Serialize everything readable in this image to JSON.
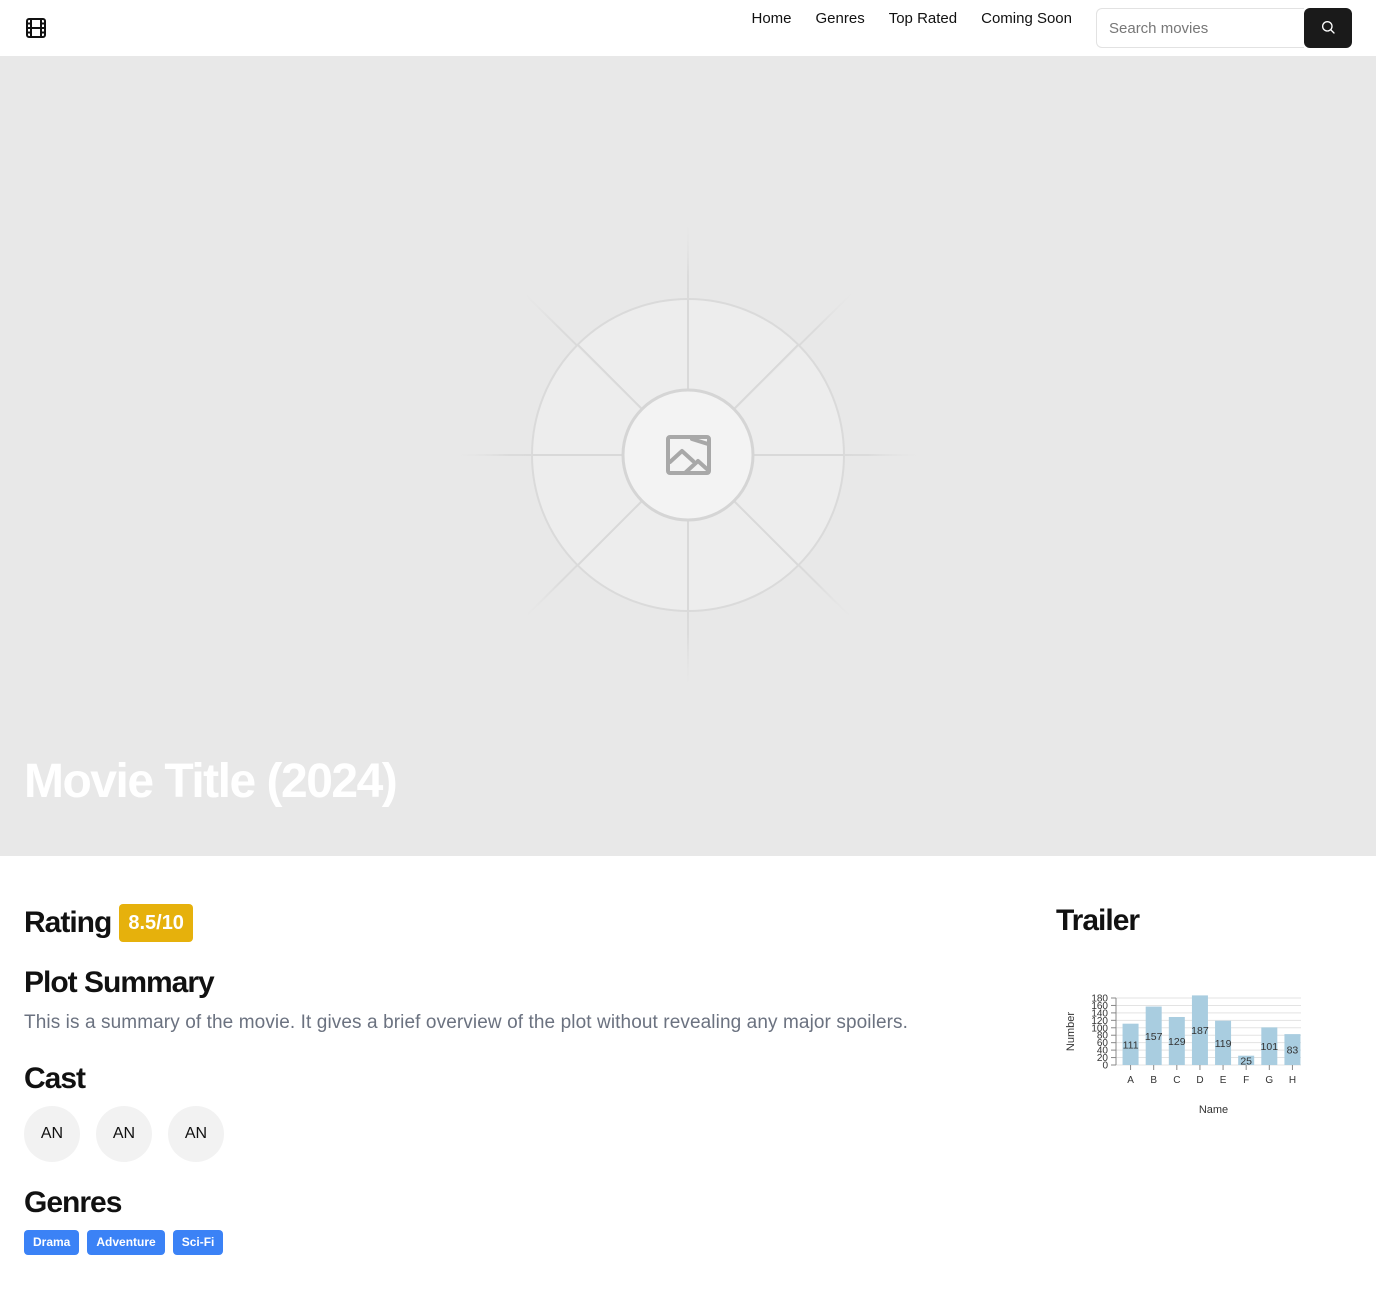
{
  "header": {
    "logo_icon": "film-icon",
    "nav": [
      "Home",
      "Genres",
      "Top Rated",
      "Coming Soon"
    ],
    "search": {
      "placeholder": "Search movies",
      "button_icon": "search-icon"
    }
  },
  "hero": {
    "title": "Movie Title (2024)",
    "placeholder_icon": "image-placeholder-icon",
    "background": "#e8e8e8"
  },
  "rating": {
    "heading": "Rating",
    "value": "8.5/10",
    "color": "#e6b10c"
  },
  "plot": {
    "heading": "Plot Summary",
    "text": "This is a summary of the movie. It gives a brief overview of the plot without revealing any major spoilers."
  },
  "cast": {
    "heading": "Cast",
    "members": [
      "AN",
      "AN",
      "AN"
    ]
  },
  "genres": {
    "heading": "Genres",
    "items": [
      "Drama",
      "Adventure",
      "Sci-Fi"
    ],
    "color": "#3b82f6"
  },
  "trailer": {
    "heading": "Trailer"
  },
  "chart_data": {
    "type": "bar",
    "categories": [
      "A",
      "B",
      "C",
      "D",
      "E",
      "F",
      "G",
      "H"
    ],
    "values": [
      111,
      157,
      129,
      187,
      119,
      25,
      101,
      83
    ],
    "title": "",
    "xlabel": "Name",
    "ylabel": "Number",
    "ylim": [
      0,
      180
    ],
    "yticks": [
      0,
      20,
      40,
      60,
      80,
      100,
      120,
      140,
      160,
      180
    ],
    "bar_color": "#a9cde0",
    "grid": true
  }
}
